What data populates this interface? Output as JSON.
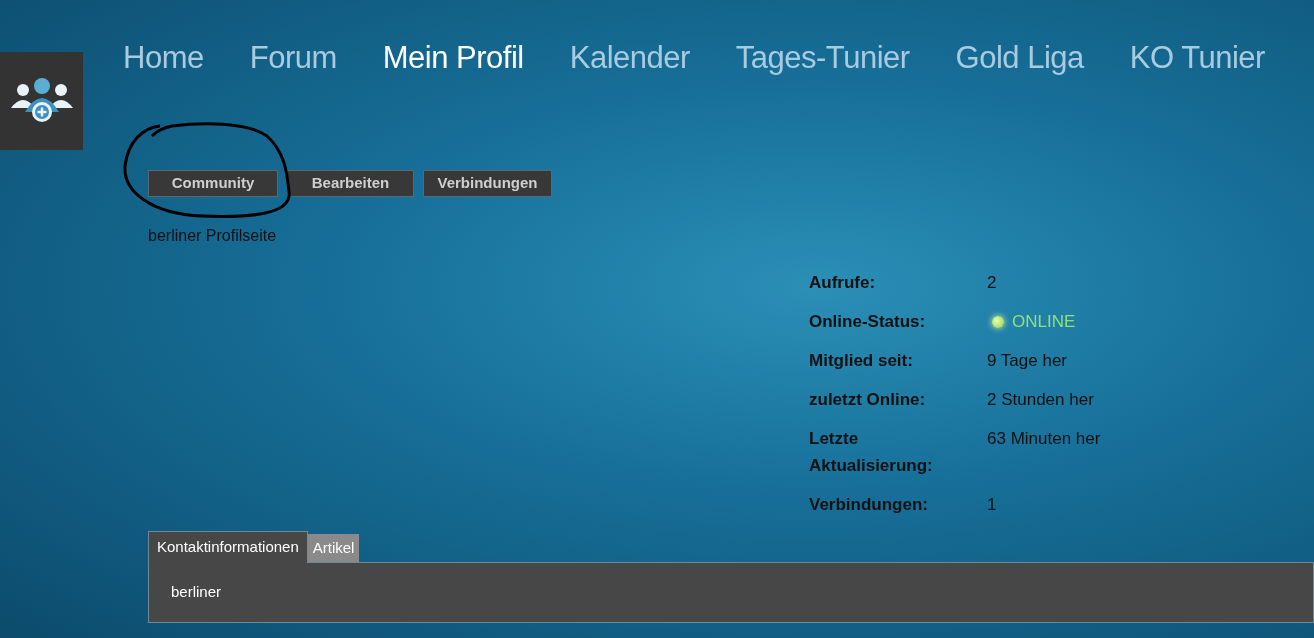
{
  "nav": [
    {
      "label": "Home",
      "selected": false
    },
    {
      "label": "Forum",
      "selected": false
    },
    {
      "label": "Mein Profil",
      "selected": true
    },
    {
      "label": "Kalender",
      "selected": false
    },
    {
      "label": "Tages-Tunier",
      "selected": false
    },
    {
      "label": "Gold Liga",
      "selected": false
    },
    {
      "label": "KO Tunier",
      "selected": false
    }
  ],
  "profile_buttons": [
    "Community",
    "Bearbeiten",
    "Verbindungen"
  ],
  "page_title": "berliner Profilseite",
  "stats": [
    {
      "kind": "text",
      "label": "Aufrufe:",
      "value": "2"
    },
    {
      "kind": "status",
      "label": "Online-Status:",
      "value": "ONLINE"
    },
    {
      "kind": "text",
      "label": "Mitglied seit:",
      "value": "9 Tage her"
    },
    {
      "kind": "text",
      "label": "zuletzt Online:",
      "value": "2 Stunden her"
    },
    {
      "kind": "text",
      "label": "Letzte Aktualisierung:",
      "value": "63 Minuten her"
    },
    {
      "kind": "text",
      "label": "Verbindungen:",
      "value": "1"
    }
  ],
  "tabs": [
    {
      "label": "Kontaktinformationen",
      "selected": true
    },
    {
      "label": "Artikel",
      "selected": false
    }
  ],
  "tab_content": "berliner"
}
